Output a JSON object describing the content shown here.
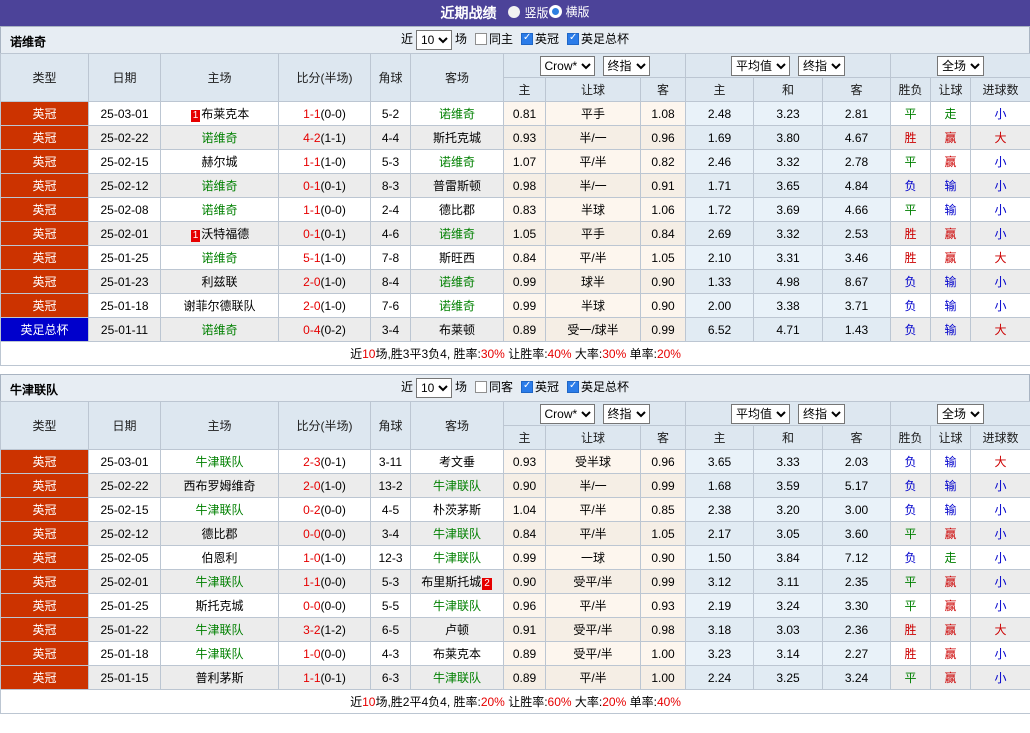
{
  "title_bar": {
    "title": "近期战绩",
    "layout_options": [
      {
        "label": "竖版",
        "selected": false
      },
      {
        "label": "横版",
        "selected": true
      }
    ]
  },
  "colors": {
    "title_bar_bg": "#4c4399",
    "league_championship_bg": "#cc3300",
    "league_facup_bg": "#0000cc",
    "win": "#cc0000",
    "draw": "#008000",
    "loss": "#0000cc",
    "self_team": "#008000",
    "score": "#e60000"
  },
  "table_header": {
    "static_cols": [
      "类型",
      "日期",
      "主场",
      "比分(半场)",
      "角球",
      "客场"
    ],
    "odds_group1_selects": [
      "Crow*",
      "终指"
    ],
    "odds_group1_cols": [
      "主",
      "让球",
      "客"
    ],
    "odds_group2_selects": [
      "平均值",
      "终指"
    ],
    "odds_group2_cols": [
      "主",
      "和",
      "客"
    ],
    "result_select": "全场",
    "result_cols": [
      "胜负",
      "让球",
      "进球数"
    ]
  },
  "sections": [
    {
      "team": "诺维奇",
      "filter": {
        "near": "近",
        "count": "10",
        "games": "场",
        "same": "同主",
        "same_checked": false,
        "league1": "英冠",
        "league1_checked": true,
        "league2": "英足总杯",
        "league2_checked": true
      },
      "rows": [
        {
          "type": "英冠",
          "type_color": "red",
          "date": "25-03-01",
          "home": "布莱克本",
          "home_badge": "1",
          "home_self": false,
          "score": "1-1",
          "half": "(0-0)",
          "corners": "5-2",
          "away": "诺维奇",
          "away_badge": "",
          "away_self": true,
          "crow_home": "0.81",
          "handicap": "平手",
          "crow_away": "1.08",
          "avg_home": "2.48",
          "avg_draw": "3.23",
          "avg_away": "2.81",
          "result": "平",
          "result_c": "green",
          "hresult": "走",
          "hresult_c": "green",
          "goals": "小",
          "goals_c": "blue"
        },
        {
          "type": "英冠",
          "type_color": "red",
          "date": "25-02-22",
          "home": "诺维奇",
          "home_badge": "",
          "home_self": true,
          "score": "4-2",
          "half": "(1-1)",
          "corners": "4-4",
          "away": "斯托克城",
          "away_badge": "",
          "away_self": false,
          "crow_home": "0.93",
          "handicap": "半/一",
          "crow_away": "0.96",
          "avg_home": "1.69",
          "avg_draw": "3.80",
          "avg_away": "4.67",
          "result": "胜",
          "result_c": "red",
          "hresult": "赢",
          "hresult_c": "red",
          "goals": "大",
          "goals_c": "red"
        },
        {
          "type": "英冠",
          "type_color": "red",
          "date": "25-02-15",
          "home": "赫尔城",
          "home_badge": "",
          "home_self": false,
          "score": "1-1",
          "half": "(1-0)",
          "corners": "5-3",
          "away": "诺维奇",
          "away_badge": "",
          "away_self": true,
          "crow_home": "1.07",
          "handicap": "平/半",
          "crow_away": "0.82",
          "avg_home": "2.46",
          "avg_draw": "3.32",
          "avg_away": "2.78",
          "result": "平",
          "result_c": "green",
          "hresult": "赢",
          "hresult_c": "red",
          "goals": "小",
          "goals_c": "blue"
        },
        {
          "type": "英冠",
          "type_color": "red",
          "date": "25-02-12",
          "home": "诺维奇",
          "home_badge": "",
          "home_self": true,
          "score": "0-1",
          "half": "(0-1)",
          "corners": "8-3",
          "away": "普雷斯顿",
          "away_badge": "",
          "away_self": false,
          "crow_home": "0.98",
          "handicap": "半/一",
          "crow_away": "0.91",
          "avg_home": "1.71",
          "avg_draw": "3.65",
          "avg_away": "4.84",
          "result": "负",
          "result_c": "blue",
          "hresult": "输",
          "hresult_c": "blue",
          "goals": "小",
          "goals_c": "blue"
        },
        {
          "type": "英冠",
          "type_color": "red",
          "date": "25-02-08",
          "home": "诺维奇",
          "home_badge": "",
          "home_self": true,
          "score": "1-1",
          "half": "(0-0)",
          "corners": "2-4",
          "away": "德比郡",
          "away_badge": "",
          "away_self": false,
          "crow_home": "0.83",
          "handicap": "半球",
          "crow_away": "1.06",
          "avg_home": "1.72",
          "avg_draw": "3.69",
          "avg_away": "4.66",
          "result": "平",
          "result_c": "green",
          "hresult": "输",
          "hresult_c": "blue",
          "goals": "小",
          "goals_c": "blue"
        },
        {
          "type": "英冠",
          "type_color": "red",
          "date": "25-02-01",
          "home": "沃特福德",
          "home_badge": "1",
          "home_self": false,
          "score": "0-1",
          "half": "(0-1)",
          "corners": "4-6",
          "away": "诺维奇",
          "away_badge": "",
          "away_self": true,
          "crow_home": "1.05",
          "handicap": "平手",
          "crow_away": "0.84",
          "avg_home": "2.69",
          "avg_draw": "3.32",
          "avg_away": "2.53",
          "result": "胜",
          "result_c": "red",
          "hresult": "赢",
          "hresult_c": "red",
          "goals": "小",
          "goals_c": "blue"
        },
        {
          "type": "英冠",
          "type_color": "red",
          "date": "25-01-25",
          "home": "诺维奇",
          "home_badge": "",
          "home_self": true,
          "score": "5-1",
          "half": "(1-0)",
          "corners": "7-8",
          "away": "斯旺西",
          "away_badge": "",
          "away_self": false,
          "crow_home": "0.84",
          "handicap": "平/半",
          "crow_away": "1.05",
          "avg_home": "2.10",
          "avg_draw": "3.31",
          "avg_away": "3.46",
          "result": "胜",
          "result_c": "red",
          "hresult": "赢",
          "hresult_c": "red",
          "goals": "大",
          "goals_c": "red"
        },
        {
          "type": "英冠",
          "type_color": "red",
          "date": "25-01-23",
          "home": "利兹联",
          "home_badge": "",
          "home_self": false,
          "score": "2-0",
          "half": "(1-0)",
          "corners": "8-4",
          "away": "诺维奇",
          "away_badge": "",
          "away_self": true,
          "crow_home": "0.99",
          "handicap": "球半",
          "crow_away": "0.90",
          "avg_home": "1.33",
          "avg_draw": "4.98",
          "avg_away": "8.67",
          "result": "负",
          "result_c": "blue",
          "hresult": "输",
          "hresult_c": "blue",
          "goals": "小",
          "goals_c": "blue"
        },
        {
          "type": "英冠",
          "type_color": "red",
          "date": "25-01-18",
          "home": "谢菲尔德联队",
          "home_badge": "",
          "home_self": false,
          "score": "2-0",
          "half": "(1-0)",
          "corners": "7-6",
          "away": "诺维奇",
          "away_badge": "",
          "away_self": true,
          "crow_home": "0.99",
          "handicap": "半球",
          "crow_away": "0.90",
          "avg_home": "2.00",
          "avg_draw": "3.38",
          "avg_away": "3.71",
          "result": "负",
          "result_c": "blue",
          "hresult": "输",
          "hresult_c": "blue",
          "goals": "小",
          "goals_c": "blue"
        },
        {
          "type": "英足总杯",
          "type_color": "blue",
          "date": "25-01-11",
          "home": "诺维奇",
          "home_badge": "",
          "home_self": true,
          "score": "0-4",
          "half": "(0-2)",
          "corners": "3-4",
          "away": "布莱顿",
          "away_badge": "",
          "away_self": false,
          "crow_home": "0.89",
          "handicap": "受一/球半",
          "crow_away": "0.99",
          "avg_home": "6.52",
          "avg_draw": "4.71",
          "avg_away": "1.43",
          "result": "负",
          "result_c": "blue",
          "hresult": "输",
          "hresult_c": "blue",
          "goals": "大",
          "goals_c": "red"
        }
      ],
      "summary": [
        {
          "text": "近",
          "red": false
        },
        {
          "text": "10",
          "red": true
        },
        {
          "text": "场,胜3平3负4, 胜率:",
          "red": false
        },
        {
          "text": "30%",
          "red": true
        },
        {
          "text": " 让胜率:",
          "red": false
        },
        {
          "text": "40%",
          "red": true
        },
        {
          "text": " 大率:",
          "red": false
        },
        {
          "text": "30%",
          "red": true
        },
        {
          "text": " 单率:",
          "red": false
        },
        {
          "text": "20%",
          "red": true
        }
      ]
    },
    {
      "team": "牛津联队",
      "filter": {
        "near": "近",
        "count": "10",
        "games": "场",
        "same": "同客",
        "same_checked": false,
        "league1": "英冠",
        "league1_checked": true,
        "league2": "英足总杯",
        "league2_checked": true
      },
      "rows": [
        {
          "type": "英冠",
          "type_color": "red",
          "date": "25-03-01",
          "home": "牛津联队",
          "home_badge": "",
          "home_self": true,
          "score": "2-3",
          "half": "(0-1)",
          "corners": "3-11",
          "away": "考文垂",
          "away_badge": "",
          "away_self": false,
          "crow_home": "0.93",
          "handicap": "受半球",
          "crow_away": "0.96",
          "avg_home": "3.65",
          "avg_draw": "3.33",
          "avg_away": "2.03",
          "result": "负",
          "result_c": "blue",
          "hresult": "输",
          "hresult_c": "blue",
          "goals": "大",
          "goals_c": "red"
        },
        {
          "type": "英冠",
          "type_color": "red",
          "date": "25-02-22",
          "home": "西布罗姆维奇",
          "home_badge": "",
          "home_self": false,
          "score": "2-0",
          "half": "(1-0)",
          "corners": "13-2",
          "away": "牛津联队",
          "away_badge": "",
          "away_self": true,
          "crow_home": "0.90",
          "handicap": "半/一",
          "crow_away": "0.99",
          "avg_home": "1.68",
          "avg_draw": "3.59",
          "avg_away": "5.17",
          "result": "负",
          "result_c": "blue",
          "hresult": "输",
          "hresult_c": "blue",
          "goals": "小",
          "goals_c": "blue"
        },
        {
          "type": "英冠",
          "type_color": "red",
          "date": "25-02-15",
          "home": "牛津联队",
          "home_badge": "",
          "home_self": true,
          "score": "0-2",
          "half": "(0-0)",
          "corners": "4-5",
          "away": "朴茨茅斯",
          "away_badge": "",
          "away_self": false,
          "crow_home": "1.04",
          "handicap": "平/半",
          "crow_away": "0.85",
          "avg_home": "2.38",
          "avg_draw": "3.20",
          "avg_away": "3.00",
          "result": "负",
          "result_c": "blue",
          "hresult": "输",
          "hresult_c": "blue",
          "goals": "小",
          "goals_c": "blue"
        },
        {
          "type": "英冠",
          "type_color": "red",
          "date": "25-02-12",
          "home": "德比郡",
          "home_badge": "",
          "home_self": false,
          "score": "0-0",
          "half": "(0-0)",
          "corners": "3-4",
          "away": "牛津联队",
          "away_badge": "",
          "away_self": true,
          "crow_home": "0.84",
          "handicap": "平/半",
          "crow_away": "1.05",
          "avg_home": "2.17",
          "avg_draw": "3.05",
          "avg_away": "3.60",
          "result": "平",
          "result_c": "green",
          "hresult": "赢",
          "hresult_c": "red",
          "goals": "小",
          "goals_c": "blue"
        },
        {
          "type": "英冠",
          "type_color": "red",
          "date": "25-02-05",
          "home": "伯恩利",
          "home_badge": "",
          "home_self": false,
          "score": "1-0",
          "half": "(1-0)",
          "corners": "12-3",
          "away": "牛津联队",
          "away_badge": "",
          "away_self": true,
          "crow_home": "0.99",
          "handicap": "一球",
          "crow_away": "0.90",
          "avg_home": "1.50",
          "avg_draw": "3.84",
          "avg_away": "7.12",
          "result": "负",
          "result_c": "blue",
          "hresult": "走",
          "hresult_c": "green",
          "goals": "小",
          "goals_c": "blue"
        },
        {
          "type": "英冠",
          "type_color": "red",
          "date": "25-02-01",
          "home": "牛津联队",
          "home_badge": "",
          "home_self": true,
          "score": "1-1",
          "half": "(0-0)",
          "corners": "5-3",
          "away": "布里斯托城",
          "away_badge": "2",
          "away_self": false,
          "crow_home": "0.90",
          "handicap": "受平/半",
          "crow_away": "0.99",
          "avg_home": "3.12",
          "avg_draw": "3.11",
          "avg_away": "2.35",
          "result": "平",
          "result_c": "green",
          "hresult": "赢",
          "hresult_c": "red",
          "goals": "小",
          "goals_c": "blue"
        },
        {
          "type": "英冠",
          "type_color": "red",
          "date": "25-01-25",
          "home": "斯托克城",
          "home_badge": "",
          "home_self": false,
          "score": "0-0",
          "half": "(0-0)",
          "corners": "5-5",
          "away": "牛津联队",
          "away_badge": "",
          "away_self": true,
          "crow_home": "0.96",
          "handicap": "平/半",
          "crow_away": "0.93",
          "avg_home": "2.19",
          "avg_draw": "3.24",
          "avg_away": "3.30",
          "result": "平",
          "result_c": "green",
          "hresult": "赢",
          "hresult_c": "red",
          "goals": "小",
          "goals_c": "blue"
        },
        {
          "type": "英冠",
          "type_color": "red",
          "date": "25-01-22",
          "home": "牛津联队",
          "home_badge": "",
          "home_self": true,
          "score": "3-2",
          "half": "(1-2)",
          "corners": "6-5",
          "away": "卢顿",
          "away_badge": "",
          "away_self": false,
          "crow_home": "0.91",
          "handicap": "受平/半",
          "crow_away": "0.98",
          "avg_home": "3.18",
          "avg_draw": "3.03",
          "avg_away": "2.36",
          "result": "胜",
          "result_c": "red",
          "hresult": "赢",
          "hresult_c": "red",
          "goals": "大",
          "goals_c": "red"
        },
        {
          "type": "英冠",
          "type_color": "red",
          "date": "25-01-18",
          "home": "牛津联队",
          "home_badge": "",
          "home_self": true,
          "score": "1-0",
          "half": "(0-0)",
          "corners": "4-3",
          "away": "布莱克本",
          "away_badge": "",
          "away_self": false,
          "crow_home": "0.89",
          "handicap": "受平/半",
          "crow_away": "1.00",
          "avg_home": "3.23",
          "avg_draw": "3.14",
          "avg_away": "2.27",
          "result": "胜",
          "result_c": "red",
          "hresult": "赢",
          "hresult_c": "red",
          "goals": "小",
          "goals_c": "blue"
        },
        {
          "type": "英冠",
          "type_color": "red",
          "date": "25-01-15",
          "home": "普利茅斯",
          "home_badge": "",
          "home_self": false,
          "score": "1-1",
          "half": "(0-1)",
          "corners": "6-3",
          "away": "牛津联队",
          "away_badge": "",
          "away_self": true,
          "crow_home": "0.89",
          "handicap": "平/半",
          "crow_away": "1.00",
          "avg_home": "2.24",
          "avg_draw": "3.25",
          "avg_away": "3.24",
          "result": "平",
          "result_c": "green",
          "hresult": "赢",
          "hresult_c": "red",
          "goals": "小",
          "goals_c": "blue"
        }
      ],
      "summary": [
        {
          "text": "近",
          "red": false
        },
        {
          "text": "10",
          "red": true
        },
        {
          "text": "场,胜2平4负4, 胜率:",
          "red": false
        },
        {
          "text": "20%",
          "red": true
        },
        {
          "text": " 让胜率:",
          "red": false
        },
        {
          "text": "60%",
          "red": true
        },
        {
          "text": " 大率:",
          "red": false
        },
        {
          "text": "20%",
          "red": true
        },
        {
          "text": " 单率:",
          "red": false
        },
        {
          "text": "40%",
          "red": true
        }
      ]
    }
  ]
}
